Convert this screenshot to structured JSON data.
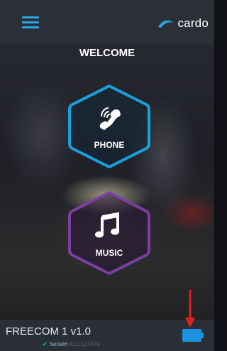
{
  "header": {
    "menu_icon": "hamburger-menu-icon",
    "logo_text": "cardo",
    "logo_icon": "cardo-swoosh-icon"
  },
  "welcome": "WELCOME",
  "buttons": {
    "phone": {
      "label": "PHONE",
      "icon": "phone-call-icon",
      "color": "#1aa0dc"
    },
    "music": {
      "label": "MUSIC",
      "icon": "music-note-icon",
      "color": "#7b3fa0"
    }
  },
  "footer": {
    "device_name": "FREECOM 1 v1.0",
    "serial_label": "Serial#:",
    "serial_value": "A111127479",
    "battery_icon": "battery-icon",
    "battery_color": "#1d92e1"
  },
  "annotation": {
    "arrow_icon": "red-arrow-down-icon",
    "color": "#e02020"
  },
  "colors": {
    "accent": "#29a7e1",
    "topbar": "#2b3038",
    "bottombar": "#2a2e35"
  }
}
